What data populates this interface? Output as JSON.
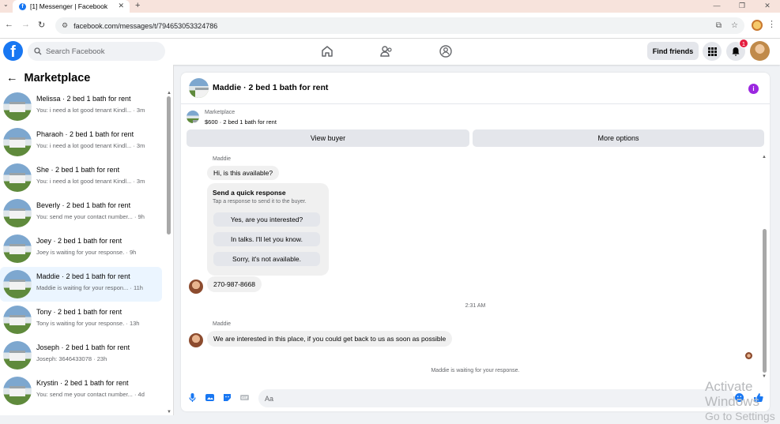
{
  "browser": {
    "tab_title": "[1] Messenger | Facebook",
    "url": "facebook.com/messages/t/794653053324786"
  },
  "header": {
    "search_placeholder": "Search Facebook",
    "find_friends": "Find friends",
    "notification_count": "1"
  },
  "sidebar": {
    "title": "Marketplace",
    "conversations": [
      {
        "title": "Melissa · 2 bed 1 bath for rent",
        "preview": "You: i need a lot good tenant Kindl... · 3m",
        "selected": false
      },
      {
        "title": "Pharaoh · 2 bed 1 bath for rent",
        "preview": "You: i need a lot good tenant Kindl... · 3m",
        "selected": false
      },
      {
        "title": "She · 2 bed 1 bath for rent",
        "preview": "You: i need a lot good tenant Kindl... · 3m",
        "selected": false
      },
      {
        "title": "Beverly · 2 bed 1 bath for rent",
        "preview": "You: send me your contact number... · 9h",
        "selected": false
      },
      {
        "title": "Joey · 2 bed 1 bath for rent",
        "preview": "Joey is waiting for your response. · 9h",
        "selected": false
      },
      {
        "title": "Maddie · 2 bed 1 bath for rent",
        "preview": "Maddie is waiting for your respon... · 11h",
        "selected": true
      },
      {
        "title": "Tony · 2 bed 1 bath for rent",
        "preview": "Tony is waiting for your response. · 13h",
        "selected": false
      },
      {
        "title": "Joseph · 2 bed 1 bath for rent",
        "preview": "Joseph: 3646433078 · 23h",
        "selected": false
      },
      {
        "title": "Krystin · 2 bed 1 bath for rent",
        "preview": "You: send me your contact number... · 4d",
        "selected": false
      }
    ]
  },
  "chat": {
    "title": "Maddie · 2 bed 1 bath for rent",
    "listing_label": "Marketplace",
    "listing_detail": "$600 · 2 bed 1 bath for rent",
    "view_buyer": "View buyer",
    "more_options": "More options",
    "sender_name": "Maddie",
    "message_1": "Hi, is this available?",
    "quick_title": "Send a quick response",
    "quick_sub": "Tap a response to send it to the buyer.",
    "quick_replies": [
      "Yes, are you interested?",
      "In talks. I'll let you know.",
      "Sorry, it's not available."
    ],
    "message_2": "270-987-8668",
    "timestamp": "2:31 AM",
    "sender_name_2": "Maddie",
    "message_3": "We are interested in this place, if you could get back to us as soon as possible",
    "waiting": "Maddie is waiting for your response.",
    "input_placeholder": "Aa"
  },
  "watermark": {
    "line1": "Activate Windows",
    "line2": "Go to Settings"
  },
  "colors": {
    "brand": "#1877f2",
    "selected_row": "#ebf5ff",
    "info_purple": "#9b27e0",
    "badge_red": "#e41e3f"
  }
}
